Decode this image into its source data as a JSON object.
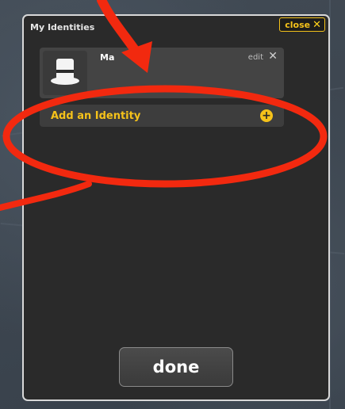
{
  "panel": {
    "title": "My Identities",
    "close_label": "close",
    "close_icon": "close-x-icon"
  },
  "identity": {
    "name": "Ma",
    "edit_label": "edit",
    "remove_icon": "remove-x-icon",
    "avatar_icon": "top-hat-icon"
  },
  "add_identity": {
    "label": "Add an Identity",
    "icon": "plus-circle-icon"
  },
  "footer": {
    "done_label": "done"
  },
  "colors": {
    "accent": "#f5c21a",
    "panel_bg": "#2a2a2a",
    "annotation": "#f2290f"
  }
}
